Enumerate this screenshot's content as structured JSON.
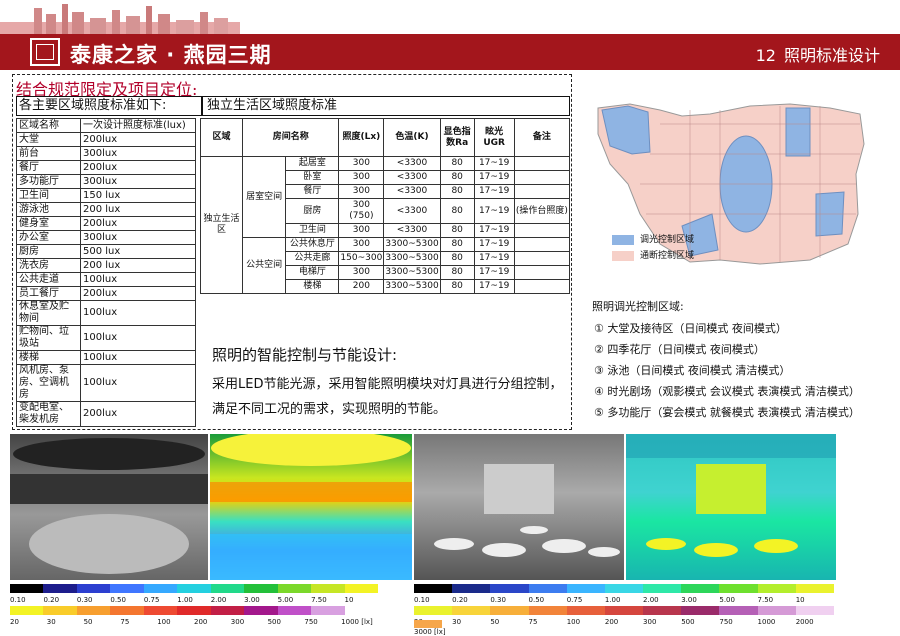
{
  "header": {
    "brand": "泰康之家 · 燕园三期",
    "page_number": "12",
    "page_title": "照明标准设计"
  },
  "main_title": "结合规范限定及项目定位:",
  "left_section": {
    "title": "各主要区域照度标准如下:",
    "table": [
      [
        "区域名称",
        "一次设计照度标准(lux)"
      ],
      [
        "大堂",
        "200lux"
      ],
      [
        "前台",
        "300lux"
      ],
      [
        "餐厅",
        "200lux"
      ],
      [
        "多功能厅",
        "300lux"
      ],
      [
        "卫生间",
        "150 lux"
      ],
      [
        "游泳池",
        "200 lux"
      ],
      [
        "健身室",
        "200lux"
      ],
      [
        "办公室",
        "300lux"
      ],
      [
        "厨房",
        "500 lux"
      ],
      [
        "洗衣房",
        "200 lux"
      ],
      [
        "公共走道",
        "100lux"
      ],
      [
        " 员工餐厅",
        "200lux"
      ],
      [
        "休息室及贮物间",
        "100lux"
      ],
      [
        "贮物间、垃圾站",
        "100lux"
      ],
      [
        "楼梯",
        "100lux"
      ],
      [
        "风机房、泵房、空调机房",
        "100lux"
      ],
      [
        "变配电室、柴发机房",
        "200lux"
      ]
    ]
  },
  "right_section": {
    "title": "独立生活区域照度标准",
    "headers": [
      "区域",
      "房间名称",
      "",
      "照度(Lx)",
      "色温(K)",
      "显色指数Ra",
      "眩光UGR",
      "备注"
    ],
    "zone": "独立生活区",
    "group1": "居室空间",
    "group2": "公共空间",
    "rows": [
      [
        "起居室",
        "300",
        "<3300",
        "80",
        "17~19",
        ""
      ],
      [
        "卧室",
        "300",
        "<3300",
        "80",
        "17~19",
        ""
      ],
      [
        "餐厅",
        "300",
        "<3300",
        "80",
        "17~19",
        ""
      ],
      [
        "厨房",
        "300 (750)",
        "<3300",
        "80",
        "17~19",
        "(操作台照度)"
      ],
      [
        "卫生间",
        "300",
        "<3300",
        "80",
        "17~19",
        ""
      ],
      [
        "公共休息厅",
        "300",
        "3300~5300",
        "80",
        "17~19",
        ""
      ],
      [
        "公共走廊",
        "150~300",
        "3300~5300",
        "80",
        "17~19",
        ""
      ],
      [
        "电梯厅",
        "300",
        "3300~5300",
        "80",
        "17~19",
        ""
      ],
      [
        "楼梯",
        "200",
        "3300~5300",
        "80",
        "17~19",
        ""
      ]
    ]
  },
  "smart_control": {
    "title": "照明的智能控制与节能设计:",
    "body": "采用LED节能光源，采用智能照明模块对灯具进行分组控制，满足不同工况的需求，实现照明的节能。"
  },
  "plan": {
    "legend_dim": "调光控制区域",
    "legend_switch": "通断控制区域",
    "color_dim": "#8fb4e3",
    "color_switch": "#f6d0c8"
  },
  "zones_title": "照明调光控制区域:",
  "zones": [
    "① 大堂及接待区（日间模式 夜间模式）",
    "② 四季花厅（日间模式 夜间模式）",
    "③ 泳池（日间模式 夜间模式 清洁模式）",
    "④ 时光剧场（观影模式 会议模式 表演模式 清洁模式）",
    "⑤ 多功能厅（宴会模式 就餐模式 表演模式 清洁模式）"
  ],
  "scale1": {
    "top": [
      "0.10",
      "0.20",
      "0.30",
      "0.50",
      "0.75",
      "1.00",
      "2.00",
      "3.00",
      "5.00",
      "7.50",
      "10"
    ],
    "bottom": [
      "20",
      "30",
      "50",
      "75",
      "100",
      "200",
      "300",
      "500",
      "750",
      "1000 [lx]"
    ],
    "colors": [
      "#000000",
      "#1d1d8c",
      "#2c3fd0",
      "#3f76ff",
      "#35a9ff",
      "#23d0e0",
      "#21d98a",
      "#23c03a",
      "#7bd82a",
      "#c6e625",
      "#f3f325",
      "#f9cc2a",
      "#f79f2f",
      "#f4762f",
      "#ee4a32",
      "#e02a2a",
      "#c21f46",
      "#a3188c",
      "#c050c8",
      "#d8a0e0",
      "#ffffff"
    ]
  },
  "scale2": {
    "top": [
      "0.10",
      "0.20",
      "0.30",
      "0.50",
      "0.75",
      "1.00",
      "2.00",
      "3.00",
      "5.00",
      "7.50",
      "10"
    ],
    "bottom": [
      "20",
      "30",
      "50",
      "75",
      "100",
      "200",
      "300",
      "500",
      "750",
      "1000",
      "2000"
    ],
    "extra": "3000 [lx]",
    "colors": [
      "#000000",
      "#1a2a8a",
      "#2a46c8",
      "#3c7cf0",
      "#3ab5ff",
      "#39d7e6",
      "#2ee8a8",
      "#2dd65a",
      "#6ee02e",
      "#b4ee2c",
      "#eaf22e",
      "#f8d43a",
      "#f7af3a",
      "#f2843a",
      "#e7603b",
      "#d5463e",
      "#b8364d",
      "#9a2b6a",
      "#b560b6",
      "#d59ad6",
      "#f0d0f0",
      "#f6a64a"
    ]
  }
}
